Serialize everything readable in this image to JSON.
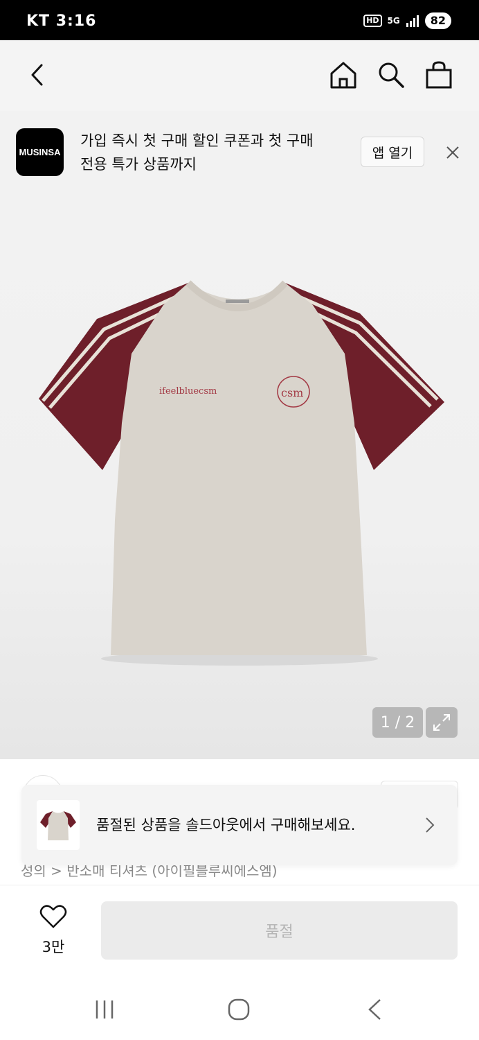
{
  "status_bar": {
    "carrier_time": "KT 3:16",
    "hd_badge": "HD",
    "network": "5G",
    "battery": "82"
  },
  "top_nav": {
    "back_icon": "chevron-left-icon",
    "home_icon": "home-icon",
    "search_icon": "search-icon",
    "cart_icon": "shopping-bag-icon"
  },
  "app_banner": {
    "logo_text": "MUSINSA",
    "message_line1": "가입 즉시 첫 구매 할인 쿠폰과 첫 구매",
    "message_line2": "전용 특가 상품까지",
    "open_app_label": "앱 열기",
    "close_icon": "close-icon"
  },
  "product_image": {
    "print_text": "ifeelbluecsm",
    "logo_text": "csm",
    "counter": "1 / 2",
    "expand_icon": "expand-icon",
    "colors": {
      "body": "#d9d4cc",
      "sleeve": "#6e1f2a",
      "stripe": "#e8e2d8"
    }
  },
  "breadcrumb": "성의 > 반소매 티셔츠 (아이필블루씨에스엠)",
  "soldout_toast": {
    "message": "품절된 상품을 솔드아웃에서 구매해보세요.",
    "chevron_icon": "chevron-right-icon"
  },
  "bottom_bar": {
    "like_icon": "heart-icon",
    "like_count": "3만",
    "buy_button_label": "품절"
  },
  "system_nav": {
    "recents_icon": "recent-apps-icon",
    "home_icon": "home-circle-icon",
    "back_icon": "back-chevron-icon"
  }
}
